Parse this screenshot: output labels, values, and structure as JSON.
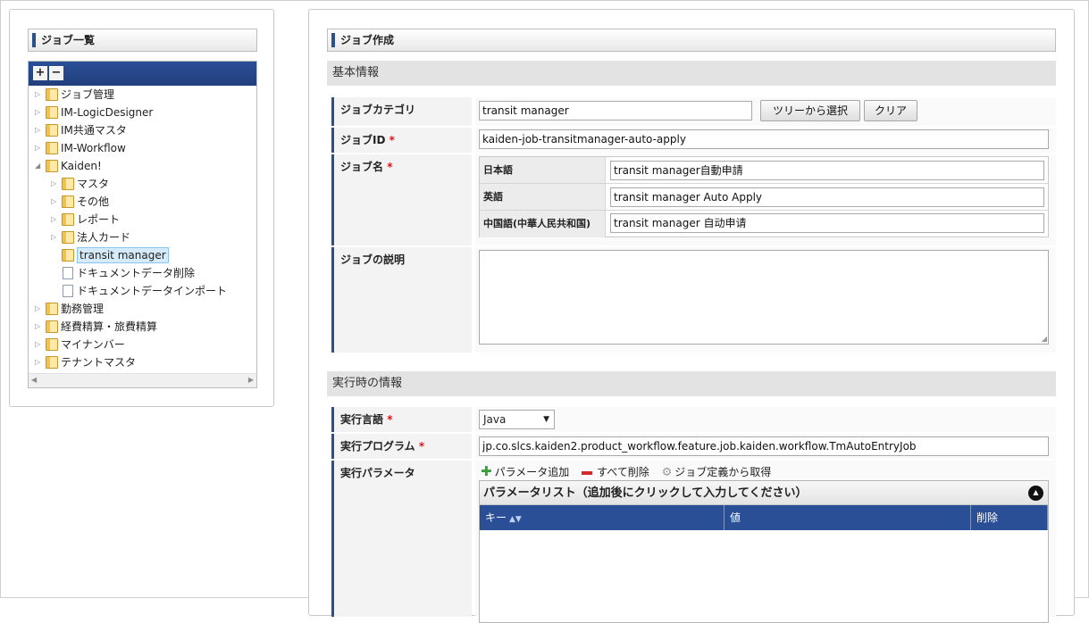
{
  "left_panel": {
    "title": "ジョブ一覧",
    "toolbar": {
      "expand_label": "+",
      "collapse_label": "−"
    },
    "tree": [
      {
        "label": "ジョブ管理",
        "type": "folder",
        "state": "collapsed",
        "level": 0
      },
      {
        "label": "IM-LogicDesigner",
        "type": "folder",
        "state": "collapsed",
        "level": 0
      },
      {
        "label": "IM共通マスタ",
        "type": "folder",
        "state": "collapsed",
        "level": 0
      },
      {
        "label": "IM-Workflow",
        "type": "folder",
        "state": "collapsed",
        "level": 0
      },
      {
        "label": "Kaiden!",
        "type": "folder",
        "state": "expanded",
        "level": 0
      },
      {
        "label": "マスタ",
        "type": "folder",
        "state": "collapsed",
        "level": 1
      },
      {
        "label": "その他",
        "type": "folder",
        "state": "collapsed",
        "level": 1
      },
      {
        "label": "レポート",
        "type": "folder",
        "state": "collapsed",
        "level": 1
      },
      {
        "label": "法人カード",
        "type": "folder",
        "state": "collapsed",
        "level": 1
      },
      {
        "label": "transit manager",
        "type": "folder",
        "state": "leaf",
        "level": 1,
        "selected": true
      },
      {
        "label": "ドキュメントデータ削除",
        "type": "file",
        "state": "leaf",
        "level": 1
      },
      {
        "label": "ドキュメントデータインポート",
        "type": "file",
        "state": "leaf",
        "level": 1
      },
      {
        "label": "勤務管理",
        "type": "folder",
        "state": "collapsed",
        "level": 0
      },
      {
        "label": "経費精算・旅費精算",
        "type": "folder",
        "state": "collapsed",
        "level": 0
      },
      {
        "label": "マイナンバー",
        "type": "folder",
        "state": "collapsed",
        "level": 0
      },
      {
        "label": "テナントマスタ",
        "type": "folder",
        "state": "collapsed",
        "level": 0
      }
    ]
  },
  "right_panel": {
    "title": "ジョブ作成",
    "basic_section": "基本情報",
    "job_category": {
      "label": "ジョブカテゴリ",
      "value": "transit manager",
      "select_button": "ツリーから選択",
      "clear_button": "クリア"
    },
    "job_id": {
      "label": "ジョブID",
      "required": "*",
      "value": "kaiden-job-transitmanager-auto-apply"
    },
    "job_name": {
      "label": "ジョブ名",
      "required": "*",
      "langs": [
        {
          "lang": "日本語",
          "value": "transit manager自動申請"
        },
        {
          "lang": "英語",
          "value": "transit manager Auto Apply"
        },
        {
          "lang": "中国語(中華人民共和国)",
          "value": "transit manager 自动申请"
        }
      ]
    },
    "job_description": {
      "label": "ジョブの説明",
      "value": ""
    },
    "exec_section": "実行時の情報",
    "exec_language": {
      "label": "実行言語",
      "required": "*",
      "value": "Java"
    },
    "exec_program": {
      "label": "実行プログラム",
      "required": "*",
      "value": "jp.co.slcs.kaiden2.product_workflow.feature.job.kaiden.workflow.TmAutoEntryJob"
    },
    "exec_params": {
      "label": "実行パラメータ",
      "add_label": "パラメータ追加",
      "delete_all_label": "すべて削除",
      "fetch_label": "ジョブ定義から取得",
      "grid_title": "パラメータリスト（追加後にクリックして入力してください）",
      "columns": [
        "キー",
        "値",
        "削除"
      ]
    }
  }
}
